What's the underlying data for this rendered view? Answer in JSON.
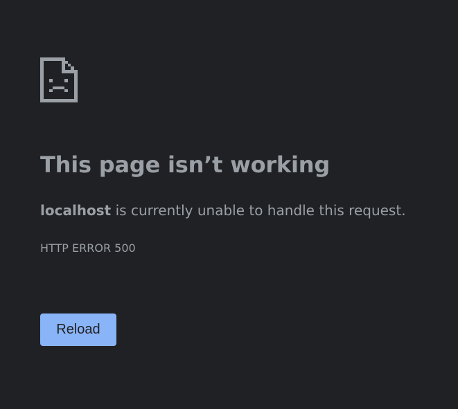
{
  "error": {
    "icon": "sad-page-icon",
    "title": "This page isn’t working",
    "host": "localhost",
    "message_rest": " is currently unable to handle this request.",
    "code": "HTTP ERROR 500"
  },
  "actions": {
    "reload_label": "Reload"
  },
  "colors": {
    "background": "#202124",
    "text": "#9aa0a6",
    "button": "#8ab4f8",
    "button_text": "#202124"
  }
}
